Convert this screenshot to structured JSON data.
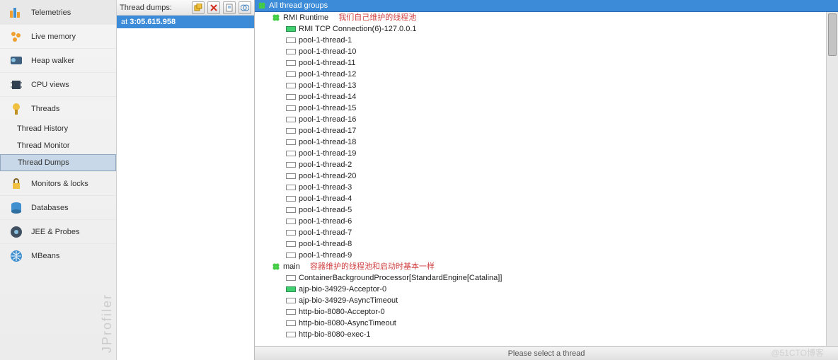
{
  "sidebar": {
    "items": [
      {
        "label": "Telemetries",
        "icon": "telemetries"
      },
      {
        "label": "Live memory",
        "icon": "livemem"
      },
      {
        "label": "Heap walker",
        "icon": "heap"
      },
      {
        "label": "CPU views",
        "icon": "cpu"
      },
      {
        "label": "Threads",
        "icon": "threads"
      }
    ],
    "subs": [
      "Thread History",
      "Thread Monitor",
      "Thread Dumps"
    ],
    "selectedSub": 2,
    "items2": [
      {
        "label": "Monitors & locks",
        "icon": "locks"
      },
      {
        "label": "Databases",
        "icon": "db"
      },
      {
        "label": "JEE & Probes",
        "icon": "probes"
      },
      {
        "label": "MBeans",
        "icon": "mbeans"
      }
    ],
    "watermark": "JProfiler"
  },
  "dumps": {
    "title": "Thread dumps:",
    "selected": {
      "prefix": "at ",
      "time": "3:05.615.958"
    }
  },
  "tree": {
    "root": "All thread groups",
    "group1": {
      "label": "RMI Runtime",
      "annotation": "我们自己维护的线程池",
      "children": [
        {
          "label": "RMI TCP Connection(6)-127.0.0.1",
          "state": "run"
        },
        {
          "label": "pool-1-thread-1",
          "state": "idle"
        },
        {
          "label": "pool-1-thread-10",
          "state": "idle"
        },
        {
          "label": "pool-1-thread-11",
          "state": "idle"
        },
        {
          "label": "pool-1-thread-12",
          "state": "idle"
        },
        {
          "label": "pool-1-thread-13",
          "state": "idle"
        },
        {
          "label": "pool-1-thread-14",
          "state": "idle"
        },
        {
          "label": "pool-1-thread-15",
          "state": "idle"
        },
        {
          "label": "pool-1-thread-16",
          "state": "idle"
        },
        {
          "label": "pool-1-thread-17",
          "state": "idle"
        },
        {
          "label": "pool-1-thread-18",
          "state": "idle"
        },
        {
          "label": "pool-1-thread-19",
          "state": "idle"
        },
        {
          "label": "pool-1-thread-2",
          "state": "idle"
        },
        {
          "label": "pool-1-thread-20",
          "state": "idle"
        },
        {
          "label": "pool-1-thread-3",
          "state": "idle"
        },
        {
          "label": "pool-1-thread-4",
          "state": "idle"
        },
        {
          "label": "pool-1-thread-5",
          "state": "idle"
        },
        {
          "label": "pool-1-thread-6",
          "state": "idle"
        },
        {
          "label": "pool-1-thread-7",
          "state": "idle"
        },
        {
          "label": "pool-1-thread-8",
          "state": "idle"
        },
        {
          "label": "pool-1-thread-9",
          "state": "idle"
        }
      ]
    },
    "group2": {
      "label": "main",
      "annotation": "容器维护的线程池和启动时基本一样",
      "children": [
        {
          "label": "ContainerBackgroundProcessor[StandardEngine[Catalina]]",
          "state": "idle"
        },
        {
          "label": "ajp-bio-34929-Acceptor-0",
          "state": "run"
        },
        {
          "label": "ajp-bio-34929-AsyncTimeout",
          "state": "idle"
        },
        {
          "label": "http-bio-8080-Acceptor-0",
          "state": "idle"
        },
        {
          "label": "http-bio-8080-AsyncTimeout",
          "state": "idle"
        },
        {
          "label": "http-bio-8080-exec-1",
          "state": "idle"
        }
      ]
    }
  },
  "status": "Please select a thread",
  "watermark2": "@51CTO博客",
  "colors": {
    "accent": "#3b8bd8",
    "folder": "#ffd860",
    "annot": "#d04040"
  }
}
